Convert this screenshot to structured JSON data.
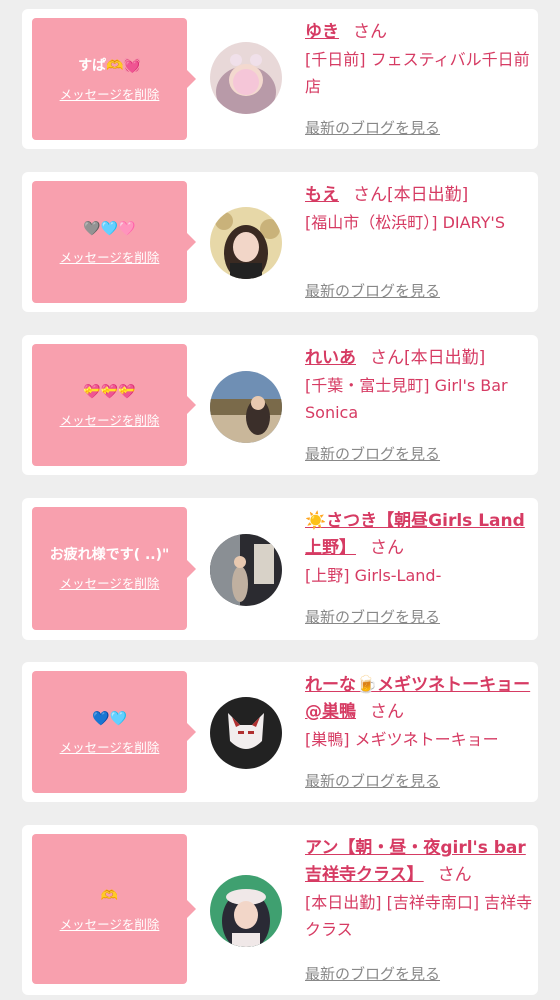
{
  "items": [
    {
      "message": "すぱ🫶💓",
      "delete_label": "メッセージを削除",
      "name": "ゆき",
      "honorific": "さん",
      "status": "",
      "shop": "[千日前] フェスティバル千日前店",
      "blog_link": "最新のブログを見る",
      "avatar_colors": [
        "#e8d8d8",
        "#b89aa8",
        "#f5c6d8"
      ]
    },
    {
      "message": "🩶🩵🩷",
      "delete_label": "メッセージを削除",
      "name": "もえ",
      "honorific": "さん",
      "status": "[本日出勤]",
      "shop": "[福山市（松浜町）] DIARY'S",
      "blog_link": "最新のブログを見る",
      "avatar_colors": [
        "#c9b27a",
        "#e7d8a8",
        "#3a2a22"
      ]
    },
    {
      "message": "💝💝💝",
      "delete_label": "メッセージを削除",
      "name": "れいあ",
      "honorific": "さん",
      "status": "[本日出勤]",
      "shop": "[千葉・富士見町] Girl's Bar Sonica",
      "blog_link": "最新のブログを見る",
      "avatar_colors": [
        "#6f8fb4",
        "#7a6a4a",
        "#c9b79a"
      ]
    },
    {
      "message": "お疲れ様です( ..)\"",
      "delete_label": "メッセージを削除",
      "name": "☀️さつき【朝昼Girls Land上野】",
      "honorific": "さん",
      "status": "",
      "shop": "[上野] Girls-Land-",
      "blog_link": "最新のブログを見る",
      "avatar_colors": [
        "#2b2b30",
        "#8a8f94",
        "#d8d2c8"
      ]
    },
    {
      "message": "💙🩵",
      "delete_label": "メッセージを削除",
      "name": "れーな🍺メギツネトーキョー@巣鴨",
      "honorific": "さん",
      "status": "",
      "shop": "[巣鴨] メギツネトーキョー",
      "blog_link": "最新のブログを見る",
      "avatar_colors": [
        "#222222",
        "#f2eeee",
        "#b03030"
      ]
    },
    {
      "message": "🫶",
      "delete_label": "メッセージを削除",
      "name": "アン【朝・昼・夜girl's bar吉祥寺クラス】",
      "honorific": "さん",
      "status": "",
      "shop": "[本日出勤] [吉祥寺南口] 吉祥寺クラス",
      "blog_link": "最新のブログを見る",
      "avatar_colors": [
        "#2a2a35",
        "#f0e8e8",
        "#3fa070"
      ]
    }
  ],
  "colors": {
    "bubble": "#f8a0ae",
    "accent": "#d63b63",
    "link_gray": "#888888",
    "background": "#eeeeee"
  }
}
